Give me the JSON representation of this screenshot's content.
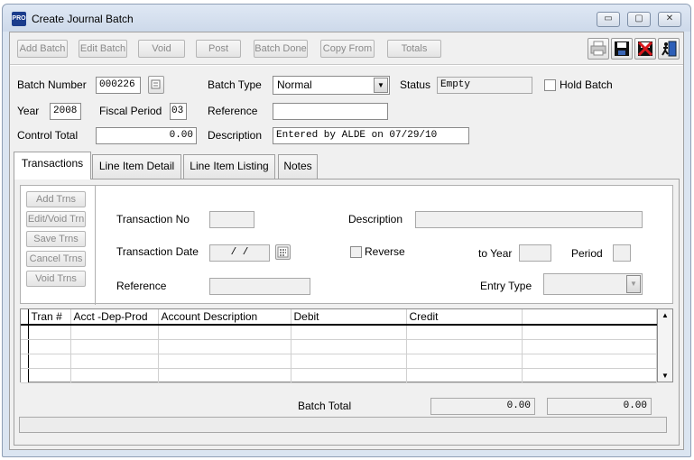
{
  "window": {
    "app_icon": "PRO",
    "title": "Create Journal Batch",
    "controls": {
      "minimize": "▭",
      "maximize": "▢",
      "close": "✕"
    }
  },
  "toolbar": {
    "buttons": [
      {
        "label": "Add Batch"
      },
      {
        "label": "Edit Batch"
      },
      {
        "label": "Void"
      },
      {
        "label": "Post"
      },
      {
        "label": "Batch Done"
      },
      {
        "label": "Copy From"
      },
      {
        "label": "Totals"
      }
    ],
    "icons": [
      "printer-icon",
      "save-icon",
      "cancel-icon",
      "exit-icon"
    ]
  },
  "header": {
    "batch_number_label": "Batch Number",
    "batch_number": "000226",
    "batch_type_label": "Batch Type",
    "batch_type": "Normal",
    "status_label": "Status",
    "status": "Empty",
    "hold_batch_label": "Hold Batch",
    "year_label": "Year",
    "year": "2008",
    "fiscal_period_label": "Fiscal Period",
    "fiscal_period": "03",
    "reference_label": "Reference",
    "reference": "",
    "control_total_label": "Control Total",
    "control_total": "0.00",
    "description_label": "Description",
    "description": "Entered by ALDE on 07/29/10"
  },
  "tabs": [
    {
      "label": "Transactions",
      "active": true
    },
    {
      "label": "Line Item Detail"
    },
    {
      "label": "Line Item Listing"
    },
    {
      "label": "Notes"
    }
  ],
  "transactions": {
    "side_buttons": [
      "Add Trns",
      "Edit/Void Trn",
      "Save Trns",
      "Cancel Trns",
      "Void Trns"
    ],
    "transaction_no_label": "Transaction No",
    "transaction_date_label": "Transaction Date",
    "transaction_date": " /  / ",
    "reference_label": "Reference",
    "description_label": "Description",
    "reverse_label": "Reverse",
    "to_year_label": "to Year",
    "period_label": "Period",
    "entry_type_label": "Entry Type"
  },
  "grid": {
    "columns": [
      "Tran #",
      "Acct -Dep-Prod",
      "Account Description",
      "Debit",
      "Credit",
      ""
    ],
    "rows": 4
  },
  "totals": {
    "label": "Batch Total",
    "debit": "0.00",
    "credit": "0.00"
  }
}
